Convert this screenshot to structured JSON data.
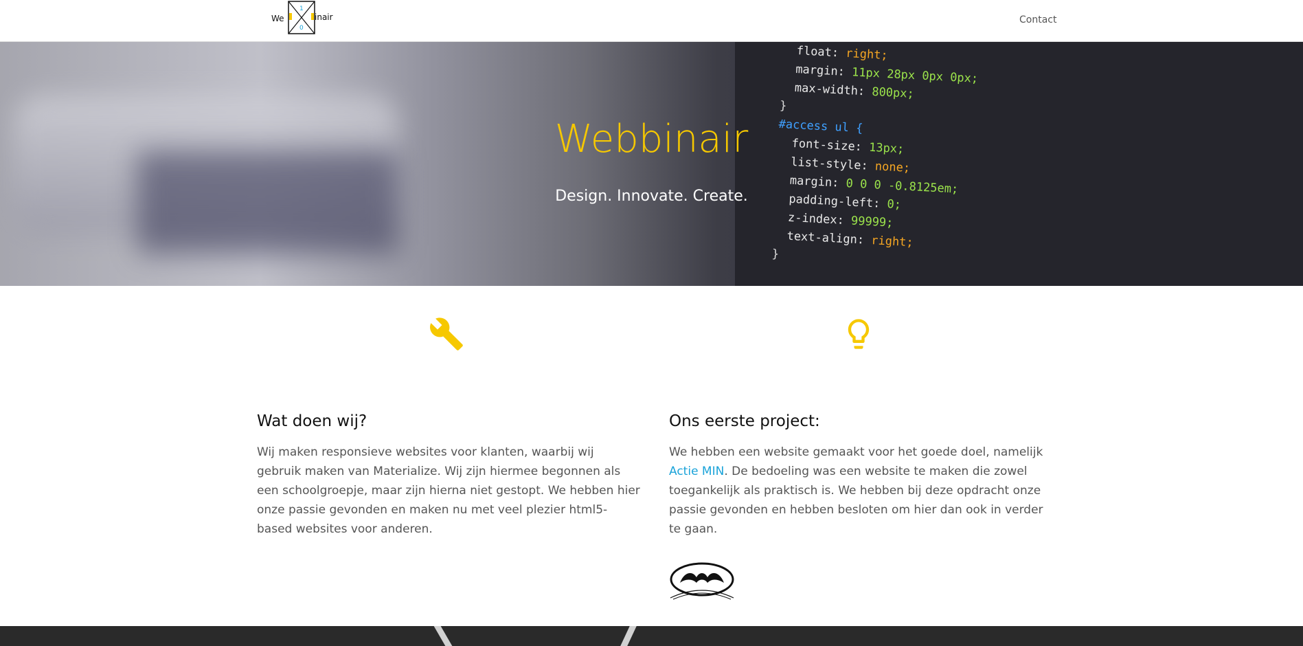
{
  "nav": {
    "logo_left": "We",
    "logo_right": "inair",
    "logo_top_digit": "1",
    "logo_bottom_digit": "0",
    "contact_label": "Contact"
  },
  "hero": {
    "title": "Webbinair",
    "subtitle": "Design. Innovate. Create.",
    "code_lines": [
      "  float: right;",
      "  margin: 11px 28px 0px 0px;",
      "  max-width: 800px;",
      "}",
      "#access ul {",
      "  font-size: 13px;",
      "  list-style: none;",
      "  margin: 0 0 0 -0.8125em;",
      "  padding-left: 0;",
      "  z-index: 99999;",
      "  text-align: right;",
      "}"
    ]
  },
  "features": [
    {
      "icon": "wrench-icon",
      "title": "Wat doen wij?",
      "text": "Wij maken responsieve websites voor klanten, waarbij wij gebruik maken van Materialize. Wij zijn hiermee begonnen als een schoolgroepje, maar zijn hierna niet gestopt. We hebben hier onze passie gevonden en maken nu met veel plezier html5-based websites voor anderen."
    },
    {
      "icon": "lightbulb-icon",
      "title": "Ons eerste project:",
      "text_before": "We hebben een website gemaakt voor het goede doel, namelijk ",
      "link_text": "Actie MIN",
      "text_after": ". De bedoeling was een website te maken die zowel toegankelijk als praktisch is. We hebben bij deze opdracht onze passie gevonden en hebben besloten om hier dan ook in verder te gaan."
    }
  ],
  "colors": {
    "accent": "#f6c800",
    "link": "#1aa3d9",
    "text": "#555555"
  }
}
